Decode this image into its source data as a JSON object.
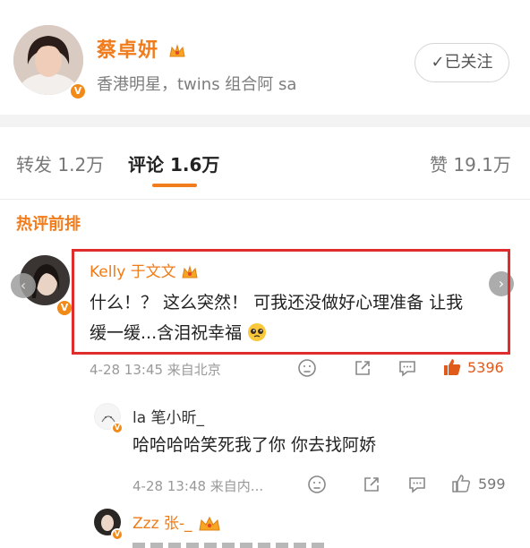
{
  "profile": {
    "name": "蔡卓妍",
    "bio": "香港明星，twins 组合阿 sa",
    "follow_label": "✓已关注",
    "verified_badge": "V"
  },
  "tabs": {
    "repost": "转发 1.2万",
    "comment": "评论 1.6万",
    "like": "赞 19.1万"
  },
  "section_title": "热评前排",
  "comments": [
    {
      "name": "Kelly 于文文",
      "text_line1": "什么！？ 这么突然！ 可我还没做好心理准备 让我",
      "text_line2": "缓一缓...含泪祝幸福",
      "time": "4-28 13:45 来自北京",
      "likes": "5396"
    },
    {
      "name": "la 笔小昕_",
      "text": "哈哈哈哈笑死我了你 你去找阿娇",
      "time": "4-28 13:48 来自内...",
      "likes": "599"
    },
    {
      "name": "Zzz 张-_"
    }
  ],
  "colors": {
    "accent": "#f07c1d",
    "highlight_border": "#df2c2c",
    "like_active": "#e05a1b"
  }
}
